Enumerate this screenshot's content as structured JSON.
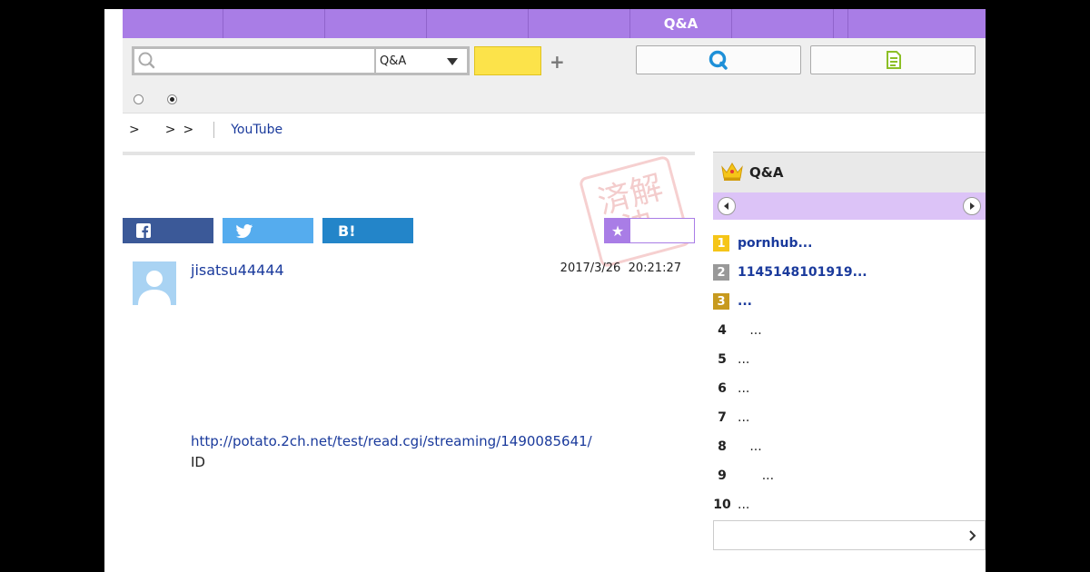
{
  "nav": {
    "tabs": [
      "",
      "",
      "",
      "",
      "",
      "Q&A",
      "",
      "",
      ""
    ]
  },
  "search": {
    "placeholder": "",
    "category_selected": "Q&A",
    "submit_label": "",
    "add_symbol": "+",
    "qa_button_icon": "q-logo-icon",
    "note_button_icon": "note-icon",
    "radio_options": [
      {
        "label": "",
        "checked": false
      },
      {
        "label": "",
        "checked": true
      }
    ]
  },
  "breadcrumb": {
    "separators": [
      ">",
      ">",
      ">"
    ],
    "link": "YouTube"
  },
  "stamp": {
    "text": "済解決"
  },
  "share": {
    "facebook": "",
    "twitter": "",
    "hatena": "B!",
    "favorite": "",
    "colors": {
      "facebook": "#3b5998",
      "twitter": "#55acee",
      "hatena": "#2385c9",
      "favorite": "#a97de6"
    }
  },
  "post": {
    "username": "jisatsu44444",
    "date": "2017/3/26",
    "time": "20:21:27",
    "url": "http://potato.2ch.net/test/read.cgi/streaming/1490085641/",
    "id_label": "ID"
  },
  "ranking": {
    "title": "Q&A",
    "items": [
      {
        "rank": "1",
        "label": "pornhub...",
        "badge": "#f5c518"
      },
      {
        "rank": "2",
        "label": "1145148101919...",
        "badge": "#999999"
      },
      {
        "rank": "3",
        "label": "...",
        "badge": "#c79a1f"
      },
      {
        "rank": "4",
        "label": "   ...",
        "badge": ""
      },
      {
        "rank": "5",
        "label": "...",
        "badge": ""
      },
      {
        "rank": "6",
        "label": "...",
        "badge": ""
      },
      {
        "rank": "7",
        "label": "...",
        "badge": ""
      },
      {
        "rank": "8",
        "label": "   ...",
        "badge": ""
      },
      {
        "rank": "9",
        "label": "      ...",
        "badge": ""
      },
      {
        "rank": "10",
        "label": "...",
        "badge": ""
      }
    ],
    "more_label": ""
  }
}
